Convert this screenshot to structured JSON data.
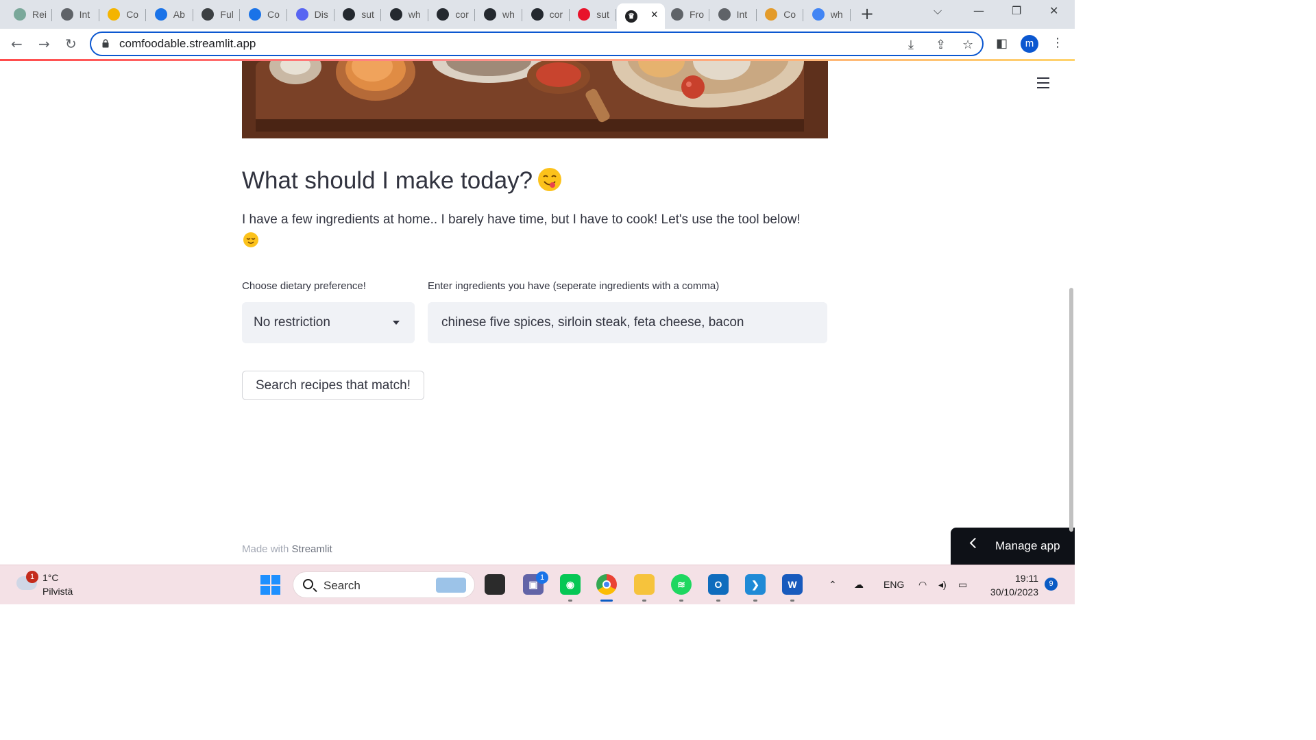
{
  "browser": {
    "tabs": [
      {
        "label": "Rei",
        "icon": "chatgpt-icon",
        "color": "#7aa89a"
      },
      {
        "label": "Int",
        "icon": "globe-icon",
        "color": "#5f6368"
      },
      {
        "label": "Co",
        "icon": "chat-bubble-icon",
        "color": "#f4b400"
      },
      {
        "label": "Ab",
        "icon": "shield-icon",
        "color": "#1a73e8"
      },
      {
        "label": "Ful",
        "icon": "square-icon",
        "color": "#3c4043"
      },
      {
        "label": "Co",
        "icon": "shield-icon",
        "color": "#1a73e8"
      },
      {
        "label": "Dis",
        "icon": "discord-icon",
        "color": "#5865f2"
      },
      {
        "label": "sut",
        "icon": "github-icon",
        "color": "#24292f"
      },
      {
        "label": "wh",
        "icon": "github-icon",
        "color": "#24292f"
      },
      {
        "label": "cor",
        "icon": "github-icon",
        "color": "#24292f"
      },
      {
        "label": "wh",
        "icon": "github-icon",
        "color": "#24292f"
      },
      {
        "label": "cor",
        "icon": "github-icon",
        "color": "#24292f"
      },
      {
        "label": "sut",
        "icon": "streamlit-crown-icon",
        "color": "#e8132a"
      }
    ],
    "active_tab": {
      "icon": "streamlit-crown-icon",
      "close": "×"
    },
    "tabs_right": [
      {
        "label": "Fro",
        "icon": "globe-icon",
        "color": "#5f6368"
      },
      {
        "label": "Int",
        "icon": "globe-icon",
        "color": "#5f6368"
      },
      {
        "label": "Co",
        "icon": "m-logo-icon",
        "color": "#e39b2a"
      },
      {
        "label": "wh",
        "icon": "google-icon",
        "color": "#4285f4"
      }
    ],
    "new_tab": "+",
    "url": "comfoodable.streamlit.app",
    "profile_initial": "m"
  },
  "page": {
    "title": "What should I make today?",
    "description": "I have a few ingredients at home.. I barely have time, but I have to cook! Let's use the tool below!",
    "diet_label": "Choose dietary preference!",
    "diet_value": "No restriction",
    "ingredients_label": "Enter ingredients you have (seperate ingredients with a comma)",
    "ingredients_value": "chinese five spices, sirloin steak, feta cheese, bacon",
    "search_button": "Search recipes that match!",
    "footer_prefix": "Made with ",
    "footer_brand": "Streamlit",
    "manage_app": "Manage app"
  },
  "taskbar": {
    "weather_badge": "1",
    "temperature": "1°C",
    "condition": "Pilvistä",
    "search_placeholder": "Search",
    "teams_badge": "1",
    "language": "ENG",
    "time": "19:11",
    "date": "30/10/2023",
    "notifications": "9"
  },
  "colors": {
    "accent": "#ff4b4b",
    "input_bg": "#f0f2f6",
    "text": "#31333f",
    "omnibox_border": "#0b57d0"
  }
}
